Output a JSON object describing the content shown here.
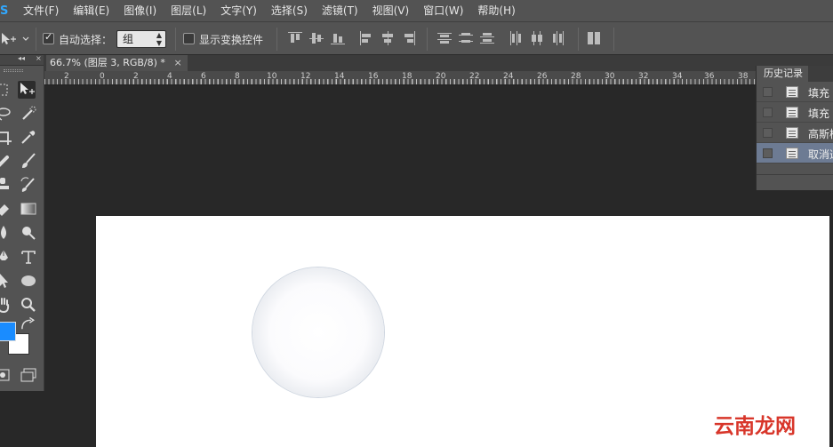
{
  "app": {
    "logo_text": "S"
  },
  "menu": {
    "items": [
      "文件(F)",
      "编辑(E)",
      "图像(I)",
      "图层(L)",
      "文字(Y)",
      "选择(S)",
      "滤镜(T)",
      "视图(V)",
      "窗口(W)",
      "帮助(H)"
    ]
  },
  "options": {
    "auto_select_label": "自动选择：",
    "auto_select_checked": true,
    "auto_select_value": "组",
    "show_transform_label": "显示变换控件",
    "show_transform_checked": false
  },
  "tools": {
    "collapse_glyph": "◂◂",
    "close_glyph": "×",
    "foreground_color": "#1a8cff",
    "background_color": "#ffffff",
    "icons": [
      "lasso-icon",
      "quick-select-icon",
      "crop-icon",
      "eyedropper-icon",
      "healing-brush-icon",
      "brush-icon",
      "clone-stamp-icon",
      "history-brush-icon",
      "eraser-icon",
      "gradient-icon",
      "blur-icon",
      "dodge-icon",
      "pen-icon",
      "type-icon",
      "path-select-icon",
      "ellipse-icon",
      "hand-icon",
      "zoom-icon",
      "move-icon"
    ]
  },
  "document": {
    "tab_title": "66.7% (图层 3, RGB/8) *",
    "tab_close": "×"
  },
  "ruler": {
    "labels": [
      "2",
      "0",
      "2",
      "4",
      "6",
      "8",
      "10",
      "12",
      "14",
      "16",
      "18",
      "20",
      "22",
      "24",
      "26",
      "28",
      "30",
      "32",
      "34",
      "36",
      "38"
    ]
  },
  "history": {
    "tab_label": "历史记录",
    "items": [
      {
        "label": "填充",
        "active": false
      },
      {
        "label": "填充",
        "active": false
      },
      {
        "label": "高斯模",
        "active": false
      },
      {
        "label": "取消选",
        "active": true
      }
    ]
  },
  "watermark": {
    "text": "云南龙网"
  }
}
